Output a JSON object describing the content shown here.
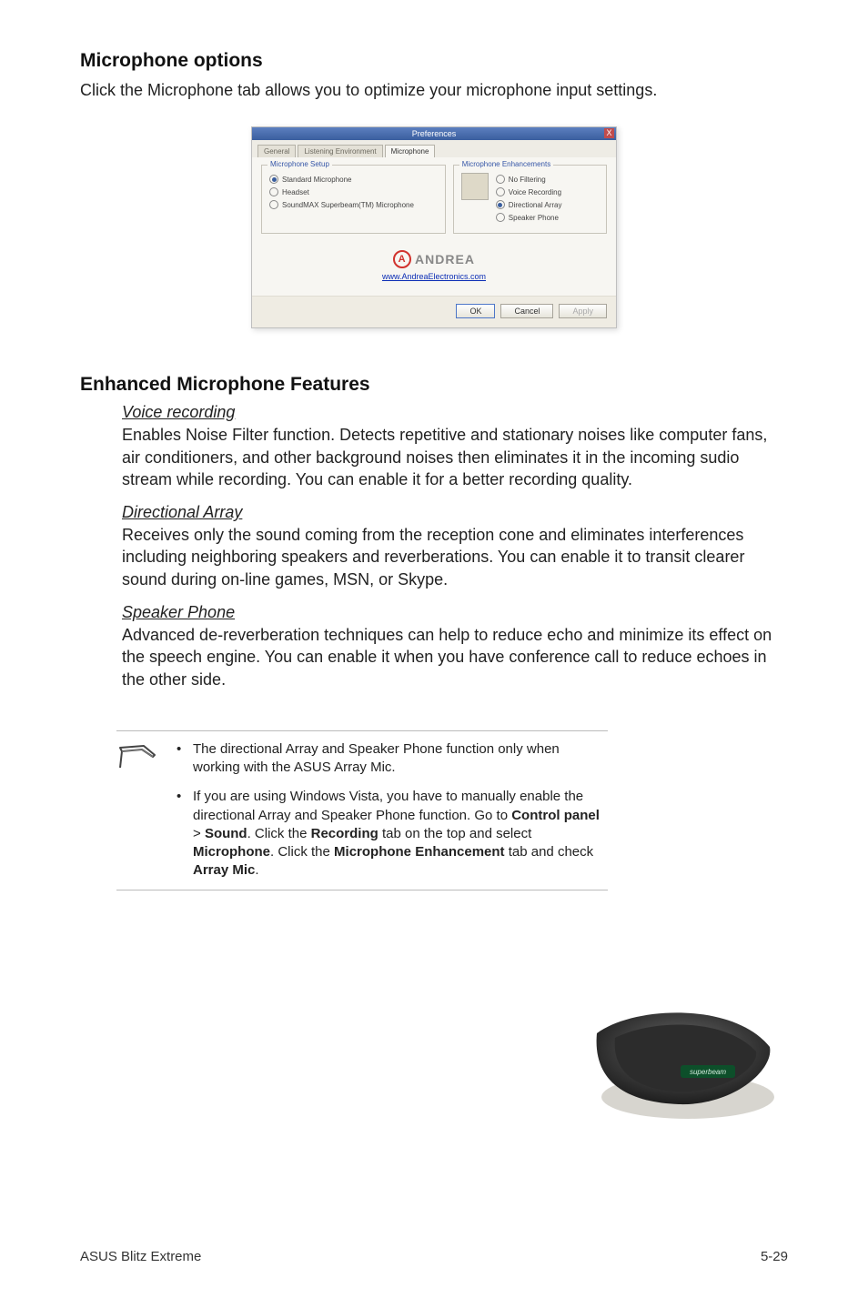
{
  "section1": {
    "title": "Microphone options",
    "intro": "Click the Microphone tab allows you to optimize your microphone input settings."
  },
  "dialog": {
    "title": "Preferences",
    "close_label": "X",
    "tabs": {
      "general": "General",
      "listening": "Listening Environment",
      "microphone": "Microphone"
    },
    "setup": {
      "legend": "Microphone Setup",
      "standard": "Standard Microphone",
      "headset": "Headset",
      "superbeam": "SoundMAX Superbeam(TM) Microphone"
    },
    "enh": {
      "legend": "Microphone Enhancements",
      "no_filtering": "No Filtering",
      "voice_recording": "Voice Recording",
      "directional_array": "Directional Array",
      "speaker_phone": "Speaker Phone"
    },
    "brand": {
      "name": "ANDREA",
      "glyph": "A",
      "url": "www.AndreaElectronics.com"
    },
    "buttons": {
      "ok": "OK",
      "cancel": "Cancel",
      "apply": "Apply"
    }
  },
  "section2": {
    "title": "Enhanced Microphone Features",
    "features": {
      "voice_recording": {
        "title": "Voice recording",
        "text": "Enables Noise Filter function. Detects repetitive and stationary noises like computer fans, air conditioners, and other background noises then eliminates it in the incoming sudio stream while recording. You can enable it for a better recording quality."
      },
      "directional_array": {
        "title": "Directional Array",
        "text": "Receives only the sound coming from the reception cone and eliminates interferences including neighboring speakers and reverberations. You can enable it to transit clearer sound during on-line games, MSN, or Skype."
      },
      "speaker_phone": {
        "title": "Speaker Phone",
        "text": "Advanced de-reverberation techniques can help to reduce echo and minimize its effect on the speech engine. You can enable it when you have conference call to reduce echoes in the other side."
      }
    }
  },
  "notes": {
    "item1": "The directional Array and Speaker Phone function only when working with the ASUS Array Mic.",
    "item2_parts": {
      "p1": "If you are using Windows Vista, you have to manually enable the directional Array and Speaker Phone function. Go to ",
      "b1": "Control panel",
      "sep1": " > ",
      "b2": "Sound",
      "p2": ". Click the ",
      "b3": "Recording",
      "p3": " tab on the top and select ",
      "b4": "Microphone",
      "p4": ". Click the ",
      "b5": "Microphone Enhancement",
      "p5": " tab and check ",
      "b6": "Array Mic",
      "p6": "."
    }
  },
  "footer": {
    "left": "ASUS Blitz Extreme",
    "right": "5-29"
  }
}
